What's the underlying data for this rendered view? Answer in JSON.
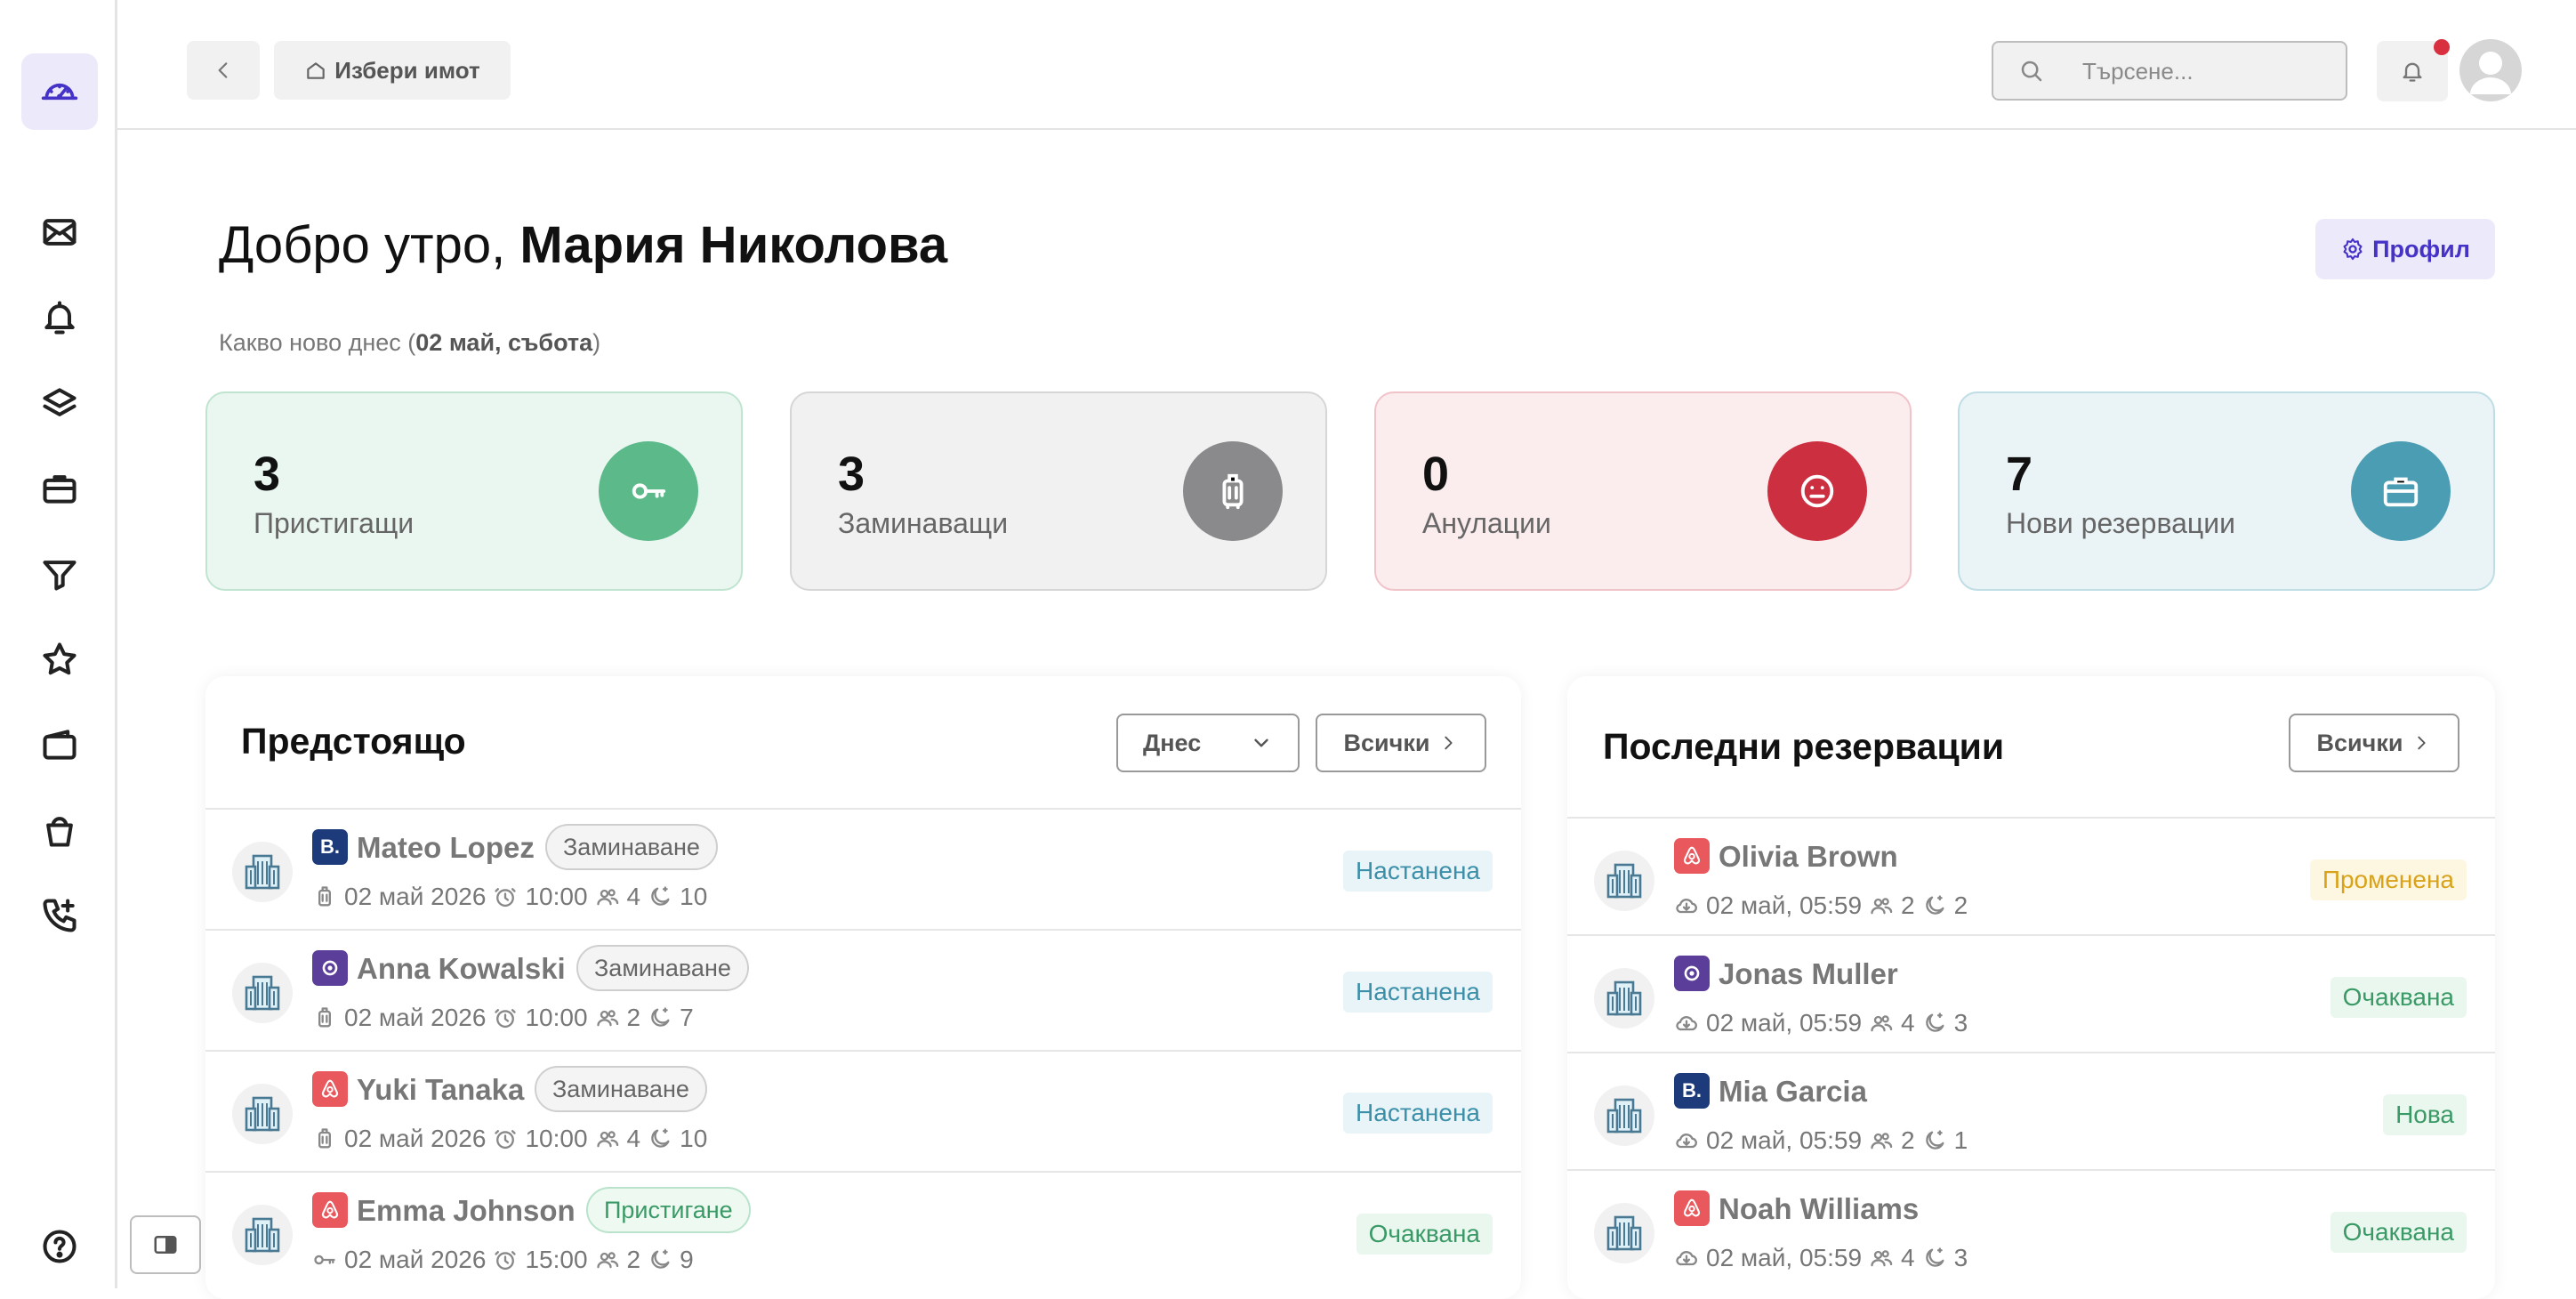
{
  "header": {
    "property_label": "Избери имот",
    "search_placeholder": "Търсене..."
  },
  "greeting": {
    "prefix": "Добро утро,",
    "name": "Мария Николова",
    "subtitle_pre": "Какво ново днес (",
    "subtitle_date": "02 май, събота",
    "subtitle_post": ")",
    "profile_label": "Профил"
  },
  "stats": [
    {
      "value": "3",
      "label": "Пристигащи",
      "color": "#5bb98a"
    },
    {
      "value": "3",
      "label": "Заминаващи",
      "color": "#8a8a8c"
    },
    {
      "value": "0",
      "label": "Анулации",
      "color": "#cc3040"
    },
    {
      "value": "7",
      "label": "Нови резервации",
      "color": "#4a9db3"
    }
  ],
  "upcoming": {
    "title": "Предстоящо",
    "filter_value": "Днес",
    "all_label": "Всички",
    "rows": [
      {
        "channel": "booking",
        "name": "Mateo Lopez",
        "tag": "Заминаване",
        "date": "02 май 2026",
        "time": "10:00",
        "guests": "4",
        "nights": "10",
        "status": "Настанена"
      },
      {
        "channel": "vrbo",
        "name": "Anna Kowalski",
        "tag": "Заминаване",
        "date": "02 май 2026",
        "time": "10:00",
        "guests": "2",
        "nights": "7",
        "status": "Настанена"
      },
      {
        "channel": "airbnb",
        "name": "Yuki Tanaka",
        "tag": "Заминаване",
        "date": "02 май 2026",
        "time": "10:00",
        "guests": "4",
        "nights": "10",
        "status": "Настанена"
      },
      {
        "channel": "airbnb",
        "name": "Emma Johnson",
        "tag": "Пристигане",
        "date": "02 май 2026",
        "time": "15:00",
        "guests": "2",
        "nights": "9",
        "status": "Очаквана"
      }
    ]
  },
  "recent": {
    "title": "Последни резервации",
    "all_label": "Всички",
    "rows": [
      {
        "channel": "airbnb",
        "name": "Olivia Brown",
        "date": "02 май, 05:59",
        "guests": "2",
        "nights": "2",
        "status": "Променена"
      },
      {
        "channel": "vrbo",
        "name": "Jonas Muller",
        "date": "02 май, 05:59",
        "guests": "4",
        "nights": "3",
        "status": "Очаквана"
      },
      {
        "channel": "booking",
        "name": "Mia Garcia",
        "date": "02 май, 05:59",
        "guests": "2",
        "nights": "1",
        "status": "Нова"
      },
      {
        "channel": "airbnb",
        "name": "Noah Williams",
        "date": "02 май, 05:59",
        "guests": "4",
        "nights": "3",
        "status": "Очаквана"
      }
    ]
  },
  "colors": {
    "accent": "#4532c7",
    "booking": "#1d3a7a",
    "vrbo": "#5b3e99",
    "airbnb": "#e8585c"
  }
}
